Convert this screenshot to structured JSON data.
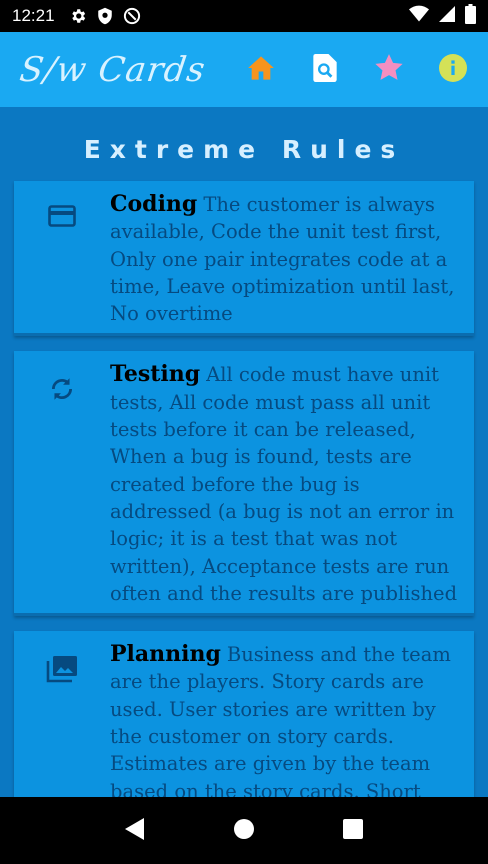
{
  "status_bar": {
    "time": "12:21",
    "left_icons": [
      "settings-icon",
      "shield-icon",
      "at-sign-icon"
    ],
    "right_icons": [
      "wifi-icon",
      "signal-icon",
      "battery-icon"
    ]
  },
  "app_bar": {
    "title": "S/w Cards",
    "color": "#1aa9f2",
    "actions": [
      {
        "icon": "home-icon",
        "color": "#f7941d"
      },
      {
        "icon": "search-document-icon",
        "color": "#ffffff"
      },
      {
        "icon": "star-icon",
        "color": "#f48fc1"
      },
      {
        "icon": "info-icon",
        "color": "#d4e157"
      }
    ]
  },
  "main": {
    "section_title": "Extreme Rules",
    "cards": [
      {
        "icon": "credit-card-icon",
        "heading": "Coding",
        "text": "The customer is always available, Code the unit test first, Only one pair integrates code at a time, Leave optimization until last, No overtime"
      },
      {
        "icon": "sync-icon",
        "heading": "Testing",
        "text": "All code must have unit tests, All code must pass all unit tests before it can be released, When a bug is found, tests are created before the bug is addressed (a bug is not an error in logic; it is a test that was not written), Acceptance tests are run often and the results are published"
      },
      {
        "icon": "photo-library-icon",
        "heading": "Planning",
        "text": "Business and the team are the players. Story cards are used. User stories are written by the customer on story cards. Estimates are given by the team based on the story cards. Short"
      }
    ]
  },
  "nav_bar": {
    "buttons": [
      "back-icon",
      "home-circle-icon",
      "recents-icon"
    ]
  }
}
